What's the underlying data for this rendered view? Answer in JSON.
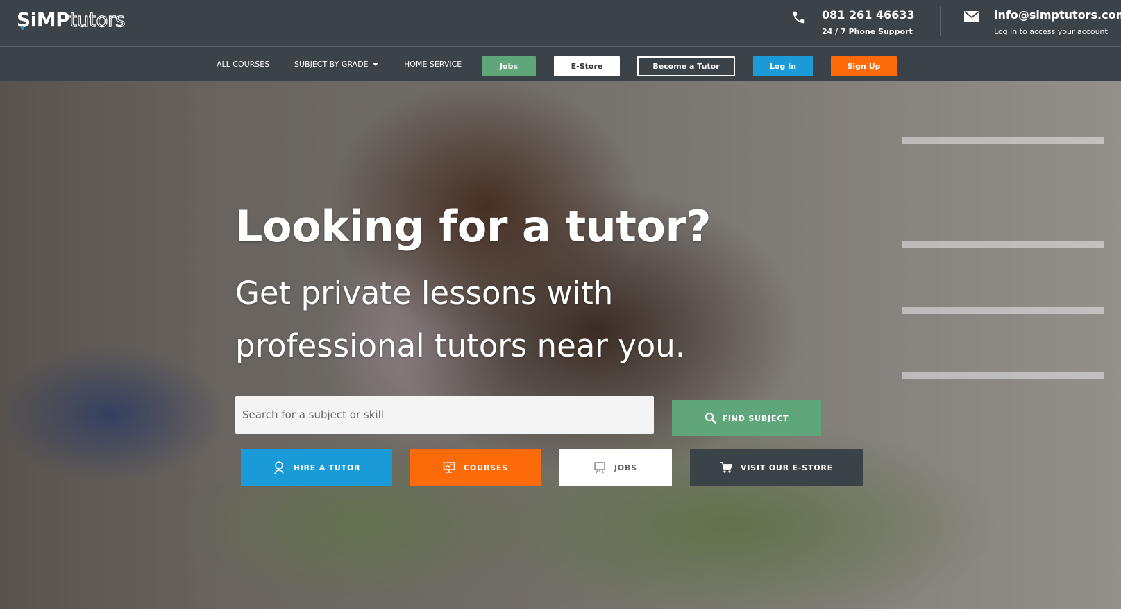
{
  "header": {
    "logo_main": "SiMP",
    "logo_sub": "tutors",
    "phone": "081 261 46633",
    "phone_sub": "24 / 7 Phone Support",
    "email": "info@simptutors.com",
    "email_sub": "Log in to access your account"
  },
  "nav": {
    "all_courses": "ALL COURSES",
    "subject_by_grade": "SUBJECT BY GRADE",
    "home_service": "HOME SERVICE",
    "jobs": "Jobs",
    "estore": "E-Store",
    "become_tutor": "Become a Tutor",
    "login": "Log In",
    "signup": "Sign Up"
  },
  "hero": {
    "headline": "Looking for a tutor?",
    "subline": "Get private lessons with professional tutors near you.",
    "search_placeholder": "Search for a subject or skill",
    "find_label": "FIND SUBJECT",
    "hire_label": "HIRE A TUTOR",
    "courses_label": "COURSES",
    "jobs_label": "JOBS",
    "estore_label": "VISIT OUR E-STORE"
  },
  "colors": {
    "topbar": "#3b4248",
    "green": "#5fa77a",
    "blue": "#1a9ad6",
    "orange": "#fd6a0a",
    "dark": "#3b4248"
  },
  "icons": [
    "phone-icon",
    "mail-icon",
    "search-icon",
    "tutor-icon",
    "presentation-icon",
    "jobs-icon",
    "cart-icon",
    "caret-down-icon"
  ]
}
